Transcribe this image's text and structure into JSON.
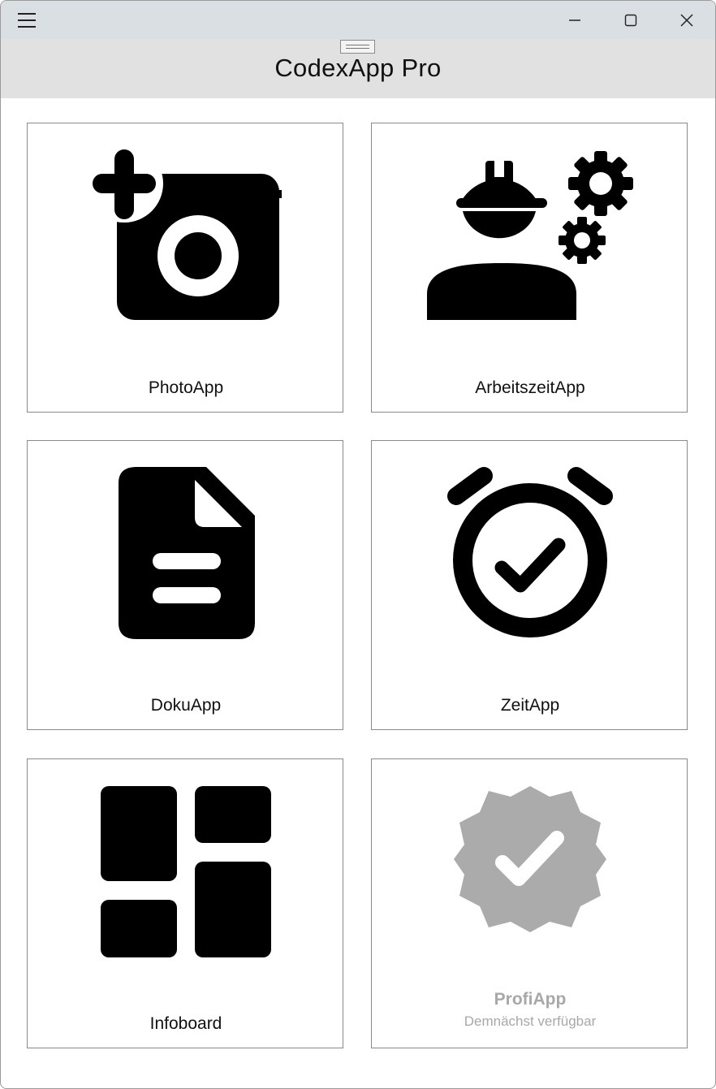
{
  "window": {
    "title": "CodexApp Pro"
  },
  "tiles": [
    {
      "label": "PhotoApp",
      "icon": "camera-add-icon"
    },
    {
      "label": "ArbeitszeitApp",
      "icon": "worker-gears-icon"
    },
    {
      "label": "DokuApp",
      "icon": "document-icon"
    },
    {
      "label": "ZeitApp",
      "icon": "alarm-clock-check-icon"
    },
    {
      "label": "Infoboard",
      "icon": "dashboard-icon"
    },
    {
      "label": "ProfiApp",
      "sublabel": "Demnächst verfügbar",
      "icon": "verified-badge-icon",
      "disabled": true
    }
  ],
  "colors": {
    "titlebar": "#dadfe4",
    "header": "#e1e1e1",
    "icon": "#000000",
    "disabled": "#a8a8a8"
  }
}
